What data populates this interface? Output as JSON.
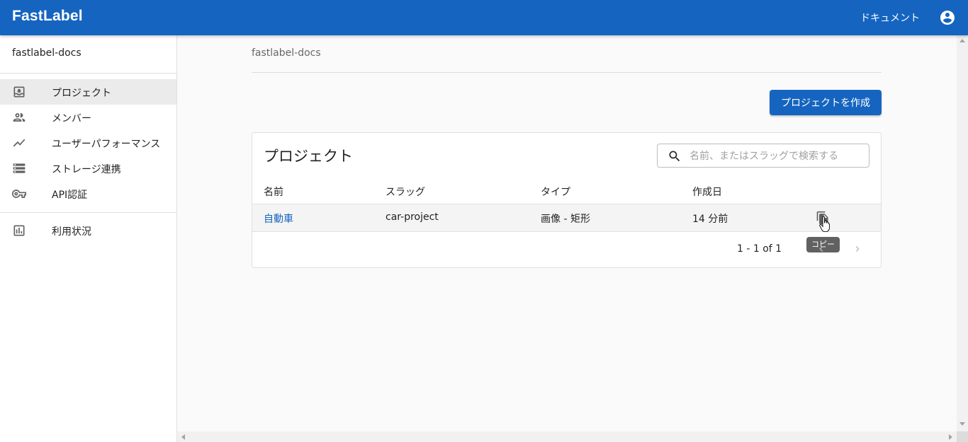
{
  "header": {
    "brand": "FastLabel",
    "documents_link": "ドキュメント",
    "account_icon": "account-circle-icon",
    "background": "#1565c0"
  },
  "sidebar": {
    "workspace_name": "fastlabel-docs",
    "items": [
      {
        "label": "プロジェクト",
        "icon": "project-icon",
        "active": true
      },
      {
        "label": "メンバー",
        "icon": "people-icon",
        "active": false
      },
      {
        "label": "ユーザーパフォーマンス",
        "icon": "trending-up-icon",
        "active": false
      },
      {
        "label": "ストレージ連携",
        "icon": "storage-icon",
        "active": false
      },
      {
        "label": "API認証",
        "icon": "key-icon",
        "active": false
      }
    ],
    "usage_item": {
      "label": "利用状況",
      "icon": "bar-chart-icon"
    }
  },
  "main": {
    "breadcrumb": "fastlabel-docs",
    "create_button": "プロジェクトを作成",
    "projects_card": {
      "title": "プロジェクト",
      "search": {
        "placeholder": "名前、またはスラッグで検索する",
        "value": ""
      },
      "columns": [
        "名前",
        "スラッグ",
        "タイプ",
        "作成日"
      ],
      "rows": [
        {
          "name": "自動車",
          "slug": "car-project",
          "type": "画像 - 矩形",
          "created": "14 分前"
        }
      ],
      "copy_tooltip": "コピー",
      "pagination": "1 - 1 of 1"
    }
  }
}
